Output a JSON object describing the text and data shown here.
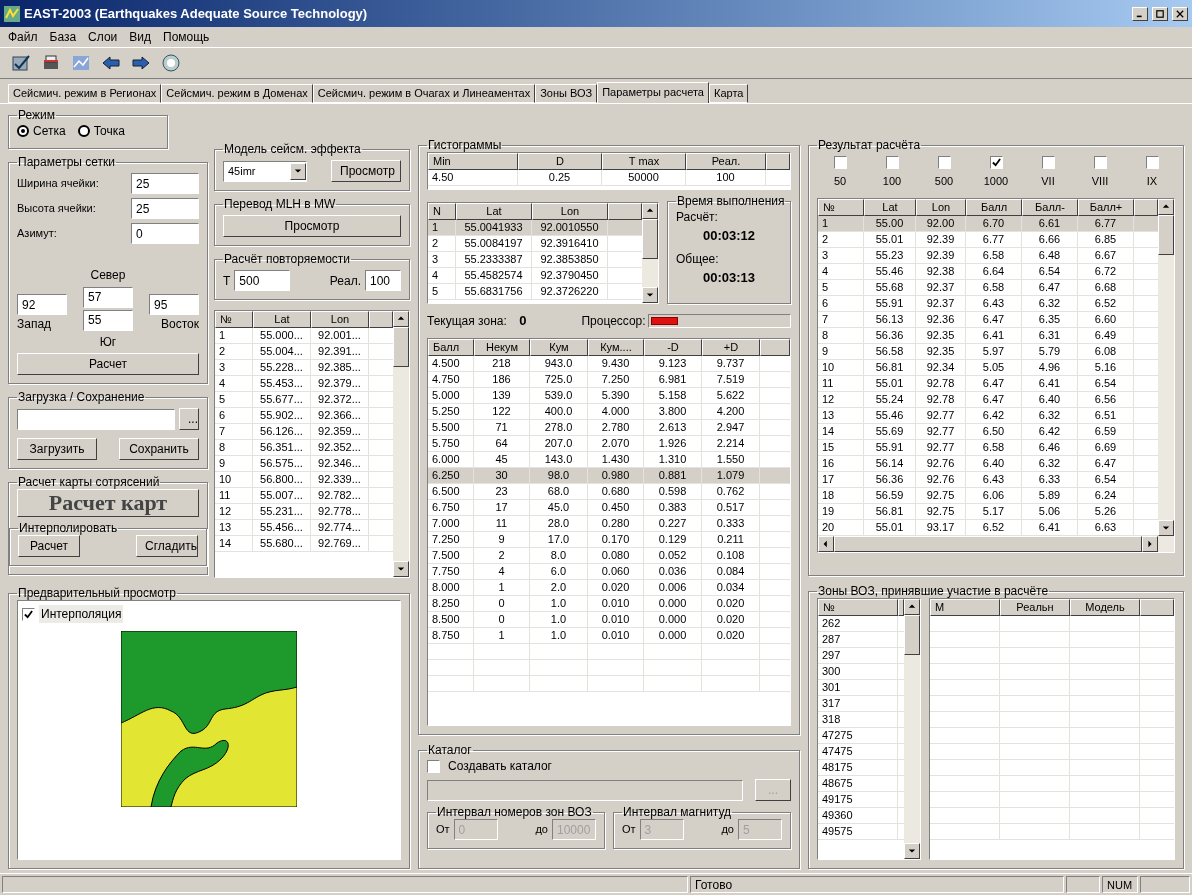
{
  "window": {
    "title": "EAST-2003 (Earthquakes Adequate Source Technology)"
  },
  "menu": [
    "Файл",
    "База",
    "Слои",
    "Вид",
    "Помощь"
  ],
  "tabs": [
    {
      "label": "Сейсмич. режим в Регионах",
      "selected": false
    },
    {
      "label": "Сейсмич. режим в Доменах",
      "selected": false
    },
    {
      "label": "Сейсмич. режим в Очагах и Линеаментах",
      "selected": false
    },
    {
      "label": "Зоны ВОЗ",
      "selected": false
    },
    {
      "label": "Параметры расчета",
      "selected": true
    },
    {
      "label": "Карта",
      "selected": false
    }
  ],
  "mode": {
    "title": "Режим",
    "options": [
      {
        "label": "Сетка",
        "selected": true
      },
      {
        "label": "Точка",
        "selected": false
      }
    ]
  },
  "grid_params": {
    "title": "Параметры сетки",
    "fields": [
      {
        "label": "Ширина ячейки:",
        "value": "25"
      },
      {
        "label": "Высота ячейки:",
        "value": "25"
      },
      {
        "label": "Азимут:",
        "value": "0"
      }
    ],
    "north_label": "Север",
    "north": "57",
    "west": "92",
    "south": "55",
    "east": "95",
    "west_label": "Запад",
    "east_label": "Восток",
    "south_label": "Юг",
    "button": "Расчет"
  },
  "load_save": {
    "title": "Загрузка / Сохранение",
    "browse": "...",
    "buttons": [
      "Загрузить",
      "Сохранить"
    ]
  },
  "shake_map": {
    "title": "Расчет карты сотрясений",
    "button": "Расчет карт",
    "interpolate": {
      "title": "Интерполировать",
      "buttons": [
        "Расчет",
        "Сгладить"
      ]
    }
  },
  "preview": {
    "title": "Предварительный просмотр",
    "checkbox": {
      "label": "Интерполяция",
      "checked": true
    }
  },
  "effect_model": {
    "title": "Модель сейсм. эффекта",
    "value": "45imr",
    "button": "Просмотр"
  },
  "mlh_mw": {
    "title": "Перевод MLH в MW",
    "button": "Просмотр"
  },
  "recurrence": {
    "title": "Расчёт повторяемости",
    "t_label": "T",
    "t": "500",
    "real_label": "Реал.",
    "real": "100"
  },
  "points_table": {
    "columns": [
      "№",
      "Lat",
      "Lon"
    ],
    "rows": [
      [
        "1",
        "55.000...",
        "92.001..."
      ],
      [
        "2",
        "55.004...",
        "92.391..."
      ],
      [
        "3",
        "55.228...",
        "92.385..."
      ],
      [
        "4",
        "55.453...",
        "92.379..."
      ],
      [
        "5",
        "55.677...",
        "92.372..."
      ],
      [
        "6",
        "55.902...",
        "92.366..."
      ],
      [
        "7",
        "56.126...",
        "92.359..."
      ],
      [
        "8",
        "56.351...",
        "92.352..."
      ],
      [
        "9",
        "56.575...",
        "92.346..."
      ],
      [
        "10",
        "56.800...",
        "92.339..."
      ],
      [
        "11",
        "55.007...",
        "92.782..."
      ],
      [
        "12",
        "55.231...",
        "92.778..."
      ],
      [
        "13",
        "55.456...",
        "92.774..."
      ],
      [
        "14",
        "55.680...",
        "92.769..."
      ]
    ]
  },
  "histograms": {
    "title": "Гистограммы",
    "params": {
      "columns": [
        "Min",
        "D",
        "T max",
        "Реал."
      ],
      "row": [
        "4.50",
        "0.25",
        "50000",
        "100"
      ]
    },
    "points": {
      "columns": [
        "N",
        "Lat",
        "Lon"
      ],
      "rows": [
        {
          "cells": [
            "1",
            "55.0041933",
            "92.0010550"
          ],
          "selected": true
        },
        {
          "cells": [
            "2",
            "55.0084197",
            "92.3916410"
          ],
          "selected": false
        },
        {
          "cells": [
            "3",
            "55.2333387",
            "92.3853850"
          ],
          "selected": false
        },
        {
          "cells": [
            "4",
            "55.4582574",
            "92.3790450"
          ],
          "selected": false
        },
        {
          "cells": [
            "5",
            "55.6831756",
            "92.3726220"
          ],
          "selected": false
        }
      ]
    },
    "timing": {
      "title": "Время выполнения",
      "calc_label": "Расчёт:",
      "calc": "00:03:12",
      "total_label": "Общее:",
      "total": "00:03:13"
    },
    "zone_label": "Текущая зона:",
    "zone": "0",
    "cpu_label": "Процессор:",
    "cpu": {
      "level": 0.2
    },
    "table": {
      "columns": [
        "Балл",
        "Некум",
        "Кум",
        "Кум....",
        "-D",
        "+D"
      ],
      "rows": [
        {
          "cells": [
            "4.500",
            "218",
            "943.0",
            "9.430",
            "9.123",
            "9.737"
          ],
          "selected": false
        },
        {
          "cells": [
            "4.750",
            "186",
            "725.0",
            "7.250",
            "6.981",
            "7.519"
          ],
          "selected": false
        },
        {
          "cells": [
            "5.000",
            "139",
            "539.0",
            "5.390",
            "5.158",
            "5.622"
          ],
          "selected": false
        },
        {
          "cells": [
            "5.250",
            "122",
            "400.0",
            "4.000",
            "3.800",
            "4.200"
          ],
          "selected": false
        },
        {
          "cells": [
            "5.500",
            "71",
            "278.0",
            "2.780",
            "2.613",
            "2.947"
          ],
          "selected": false
        },
        {
          "cells": [
            "5.750",
            "64",
            "207.0",
            "2.070",
            "1.926",
            "2.214"
          ],
          "selected": false
        },
        {
          "cells": [
            "6.000",
            "45",
            "143.0",
            "1.430",
            "1.310",
            "1.550"
          ],
          "selected": false
        },
        {
          "cells": [
            "6.250",
            "30",
            "98.0",
            "0.980",
            "0.881",
            "1.079"
          ],
          "selected": true
        },
        {
          "cells": [
            "6.500",
            "23",
            "68.0",
            "0.680",
            "0.598",
            "0.762"
          ],
          "selected": false
        },
        {
          "cells": [
            "6.750",
            "17",
            "45.0",
            "0.450",
            "0.383",
            "0.517"
          ],
          "selected": false
        },
        {
          "cells": [
            "7.000",
            "11",
            "28.0",
            "0.280",
            "0.227",
            "0.333"
          ],
          "selected": false
        },
        {
          "cells": [
            "7.250",
            "9",
            "17.0",
            "0.170",
            "0.129",
            "0.211"
          ],
          "selected": false
        },
        {
          "cells": [
            "7.500",
            "2",
            "8.0",
            "0.080",
            "0.052",
            "0.108"
          ],
          "selected": false
        },
        {
          "cells": [
            "7.750",
            "4",
            "6.0",
            "0.060",
            "0.036",
            "0.084"
          ],
          "selected": false
        },
        {
          "cells": [
            "8.000",
            "1",
            "2.0",
            "0.020",
            "0.006",
            "0.034"
          ],
          "selected": false
        },
        {
          "cells": [
            "8.250",
            "0",
            "1.0",
            "0.010",
            "0.000",
            "0.020"
          ],
          "selected": false
        },
        {
          "cells": [
            "8.500",
            "0",
            "1.0",
            "0.010",
            "0.000",
            "0.020"
          ],
          "selected": false
        },
        {
          "cells": [
            "8.750",
            "1",
            "1.0",
            "0.010",
            "0.000",
            "0.020"
          ],
          "selected": false
        }
      ]
    }
  },
  "catalog": {
    "title": "Каталог",
    "checkbox": {
      "label": "Создавать каталог",
      "checked": false
    },
    "disabled": true,
    "browse": "...",
    "zones": {
      "title": "Интервал номеров зон ВОЗ",
      "from_label": "От",
      "from": "0",
      "to_label": "до",
      "to": "10000"
    },
    "magnitudes": {
      "title": "Интервал магнитуд",
      "from_label": "От",
      "from": "3",
      "to_label": "до",
      "to": "5"
    }
  },
  "result": {
    "title": "Результат расчёта",
    "checks": [
      {
        "label": "50",
        "checked": false
      },
      {
        "label": "100",
        "checked": false
      },
      {
        "label": "500",
        "checked": false
      },
      {
        "label": "1000",
        "checked": true
      },
      {
        "label": "VII",
        "checked": false
      },
      {
        "label": "VIII",
        "checked": false
      },
      {
        "label": "IX",
        "checked": false
      }
    ],
    "table": {
      "columns": [
        "№",
        "Lat",
        "Lon",
        "Балл",
        "Балл-",
        "Балл+"
      ],
      "rows": [
        {
          "cells": [
            "1",
            "55.00",
            "92.00",
            "6.70",
            "6.61",
            "6.77"
          ],
          "selected": true
        },
        {
          "cells": [
            "2",
            "55.01",
            "92.39",
            "6.77",
            "6.66",
            "6.85"
          ],
          "selected": false
        },
        {
          "cells": [
            "3",
            "55.23",
            "92.39",
            "6.58",
            "6.48",
            "6.67"
          ],
          "selected": false
        },
        {
          "cells": [
            "4",
            "55.46",
            "92.38",
            "6.64",
            "6.54",
            "6.72"
          ],
          "selected": false
        },
        {
          "cells": [
            "5",
            "55.68",
            "92.37",
            "6.58",
            "6.47",
            "6.68"
          ],
          "selected": false
        },
        {
          "cells": [
            "6",
            "55.91",
            "92.37",
            "6.43",
            "6.32",
            "6.52"
          ],
          "selected": false
        },
        {
          "cells": [
            "7",
            "56.13",
            "92.36",
            "6.47",
            "6.35",
            "6.60"
          ],
          "selected": false
        },
        {
          "cells": [
            "8",
            "56.36",
            "92.35",
            "6.41",
            "6.31",
            "6.49"
          ],
          "selected": false
        },
        {
          "cells": [
            "9",
            "56.58",
            "92.35",
            "5.97",
            "5.79",
            "6.08"
          ],
          "selected": false
        },
        {
          "cells": [
            "10",
            "56.81",
            "92.34",
            "5.05",
            "4.96",
            "5.16"
          ],
          "selected": false
        },
        {
          "cells": [
            "11",
            "55.01",
            "92.78",
            "6.47",
            "6.41",
            "6.54"
          ],
          "selected": false
        },
        {
          "cells": [
            "12",
            "55.24",
            "92.78",
            "6.47",
            "6.40",
            "6.56"
          ],
          "selected": false
        },
        {
          "cells": [
            "13",
            "55.46",
            "92.77",
            "6.42",
            "6.32",
            "6.51"
          ],
          "selected": false
        },
        {
          "cells": [
            "14",
            "55.69",
            "92.77",
            "6.50",
            "6.42",
            "6.59"
          ],
          "selected": false
        },
        {
          "cells": [
            "15",
            "55.91",
            "92.77",
            "6.58",
            "6.46",
            "6.69"
          ],
          "selected": false
        },
        {
          "cells": [
            "16",
            "56.14",
            "92.76",
            "6.40",
            "6.32",
            "6.47"
          ],
          "selected": false
        },
        {
          "cells": [
            "17",
            "56.36",
            "92.76",
            "6.43",
            "6.33",
            "6.54"
          ],
          "selected": false
        },
        {
          "cells": [
            "18",
            "56.59",
            "92.75",
            "6.06",
            "5.89",
            "6.24"
          ],
          "selected": false
        },
        {
          "cells": [
            "19",
            "56.81",
            "92.75",
            "5.17",
            "5.06",
            "5.26"
          ],
          "selected": false
        },
        {
          "cells": [
            "20",
            "55.01",
            "93.17",
            "6.52",
            "6.41",
            "6.63"
          ],
          "selected": false
        }
      ]
    }
  },
  "zones": {
    "title": "Зоны ВОЗ, принявшие участие в расчёте",
    "ids": {
      "column": "№",
      "rows": [
        "262",
        "287",
        "297",
        "300",
        "301",
        "317",
        "318",
        "47275",
        "47475",
        "48175",
        "48675",
        "49175",
        "49360",
        "49575"
      ]
    },
    "table": {
      "columns": [
        "M",
        "Реальн",
        "Модель"
      ]
    }
  },
  "status_bar": {
    "message": "Готово",
    "num": "NUM"
  }
}
